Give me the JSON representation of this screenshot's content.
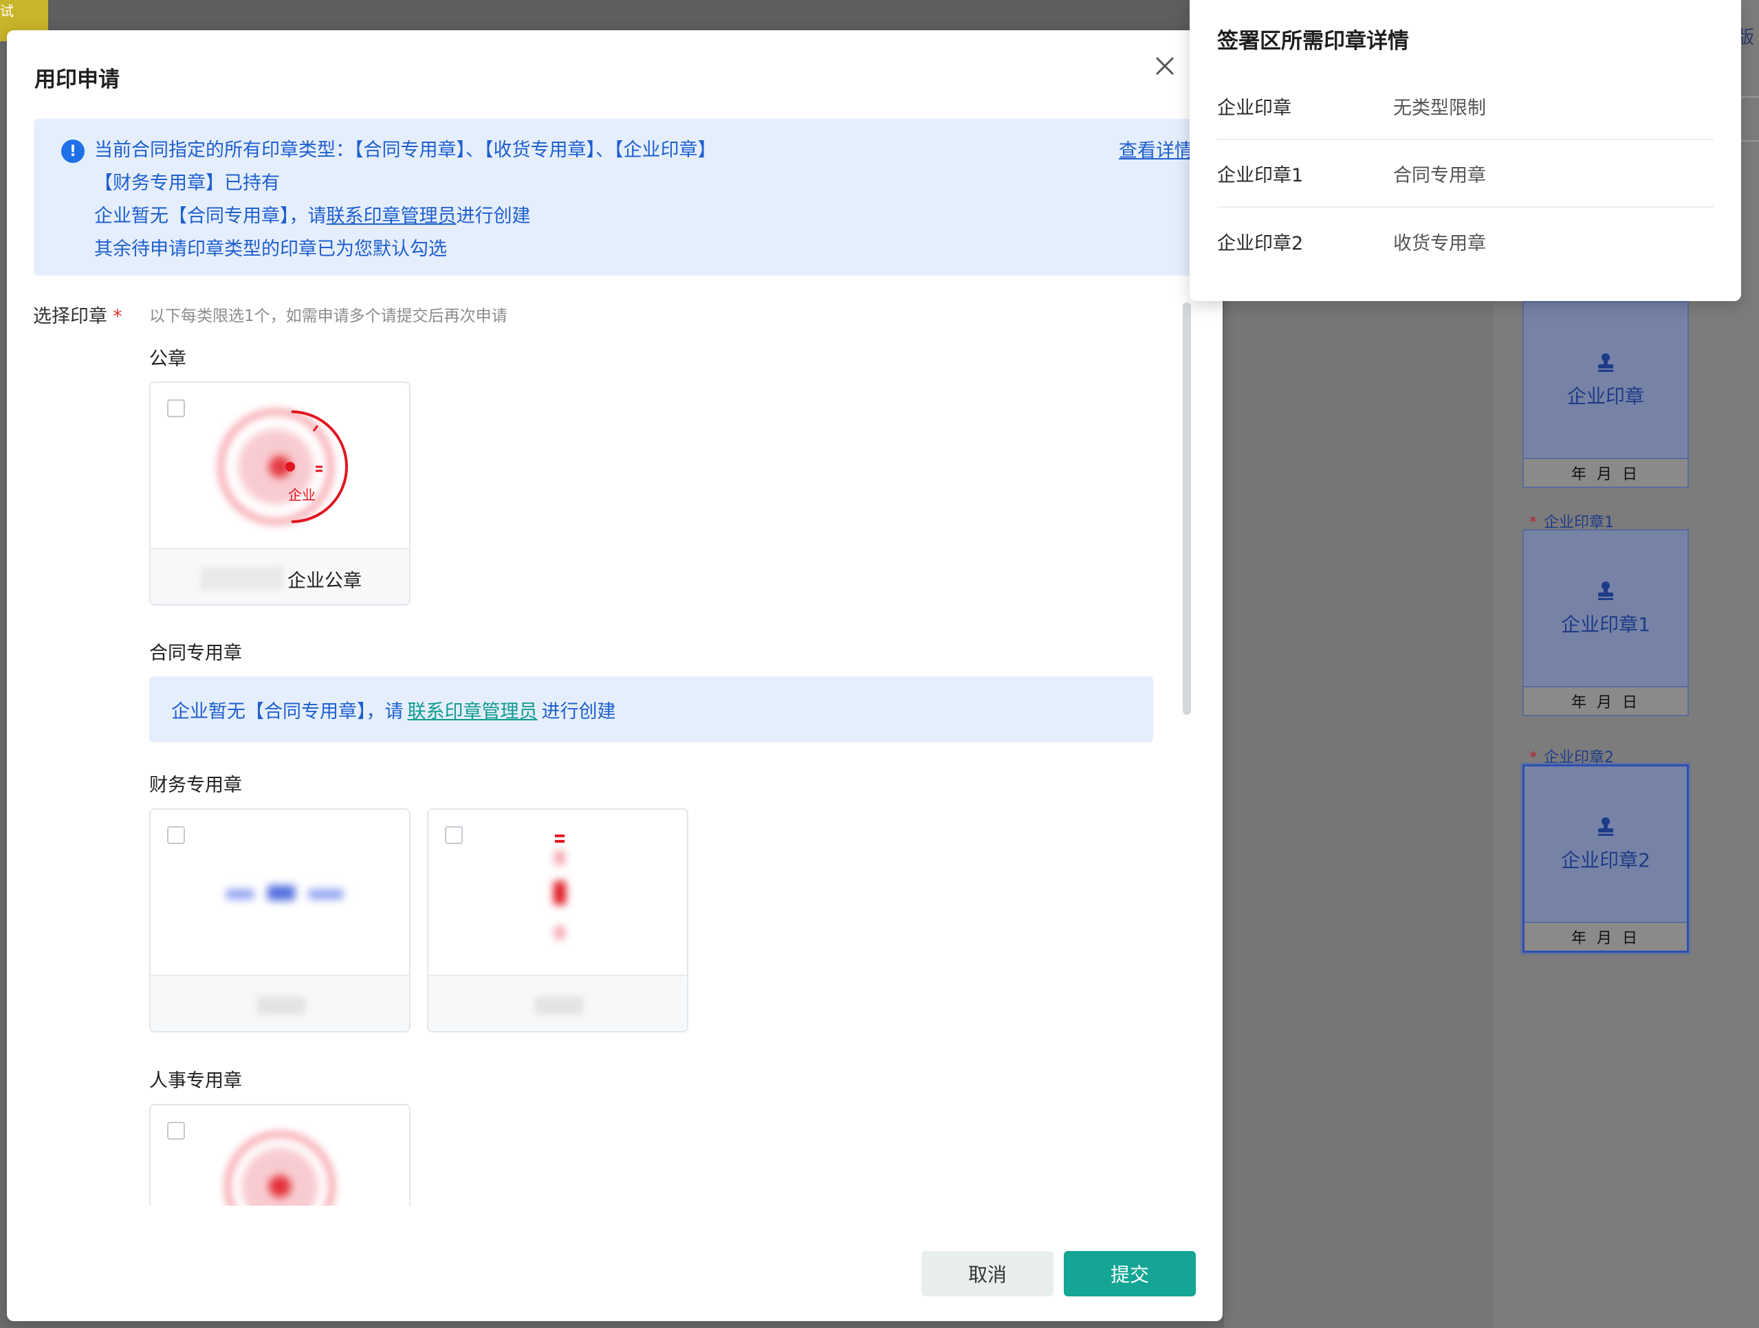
{
  "background": {
    "corner_tag": "试",
    "corner_char": "版",
    "seats": [
      {
        "label": "",
        "name": "企业印章",
        "date": "年 月 日"
      },
      {
        "label": "企业印章1",
        "name": "企业印章1",
        "date": "年 月 日"
      },
      {
        "label": "企业印章2",
        "name": "企业印章2",
        "date": "年 月 日"
      }
    ]
  },
  "dialog": {
    "title": "用印申请",
    "notice": {
      "line1": "当前合同指定的所有印章类型：【合同专用章】、【收货专用章】、【企业印章】",
      "line2": "【财务专用章】已持有",
      "line3_prefix": "企业暂无【合同专用章】，请",
      "line3_link": "联系印章管理员",
      "line3_suffix": "进行创建",
      "line4": "其余待申请印章类型的印章已为您默认勾选",
      "detail_link": "查看详情"
    },
    "field_label": "选择印章",
    "field_hint": "以下每类限选1个，如需申请多个请提交后再次申请",
    "sections": {
      "public": {
        "title": "公章",
        "cards": [
          {
            "name": "企业公章",
            "seal_text": "企业"
          }
        ]
      },
      "contract": {
        "title": "合同专用章",
        "missing_prefix": "企业暂无【合同专用章】，请",
        "missing_link": "联系印章管理员",
        "missing_suffix": "进行创建"
      },
      "finance": {
        "title": "财务专用章",
        "cards": [
          {
            "name": ""
          },
          {
            "name": ""
          }
        ]
      },
      "hr": {
        "title": "人事专用章"
      }
    },
    "buttons": {
      "cancel": "取消",
      "submit": "提交"
    }
  },
  "popover": {
    "title": "签署区所需印章详情",
    "rows": [
      {
        "seal": "企业印章",
        "type": "无类型限制"
      },
      {
        "seal": "企业印章1",
        "type": "合同专用章"
      },
      {
        "seal": "企业印章2",
        "type": "收货专用章"
      }
    ]
  },
  "colors": {
    "primary_blue": "#1f5fcf",
    "teal": "#14a594",
    "seal_red": "#e0161f"
  }
}
